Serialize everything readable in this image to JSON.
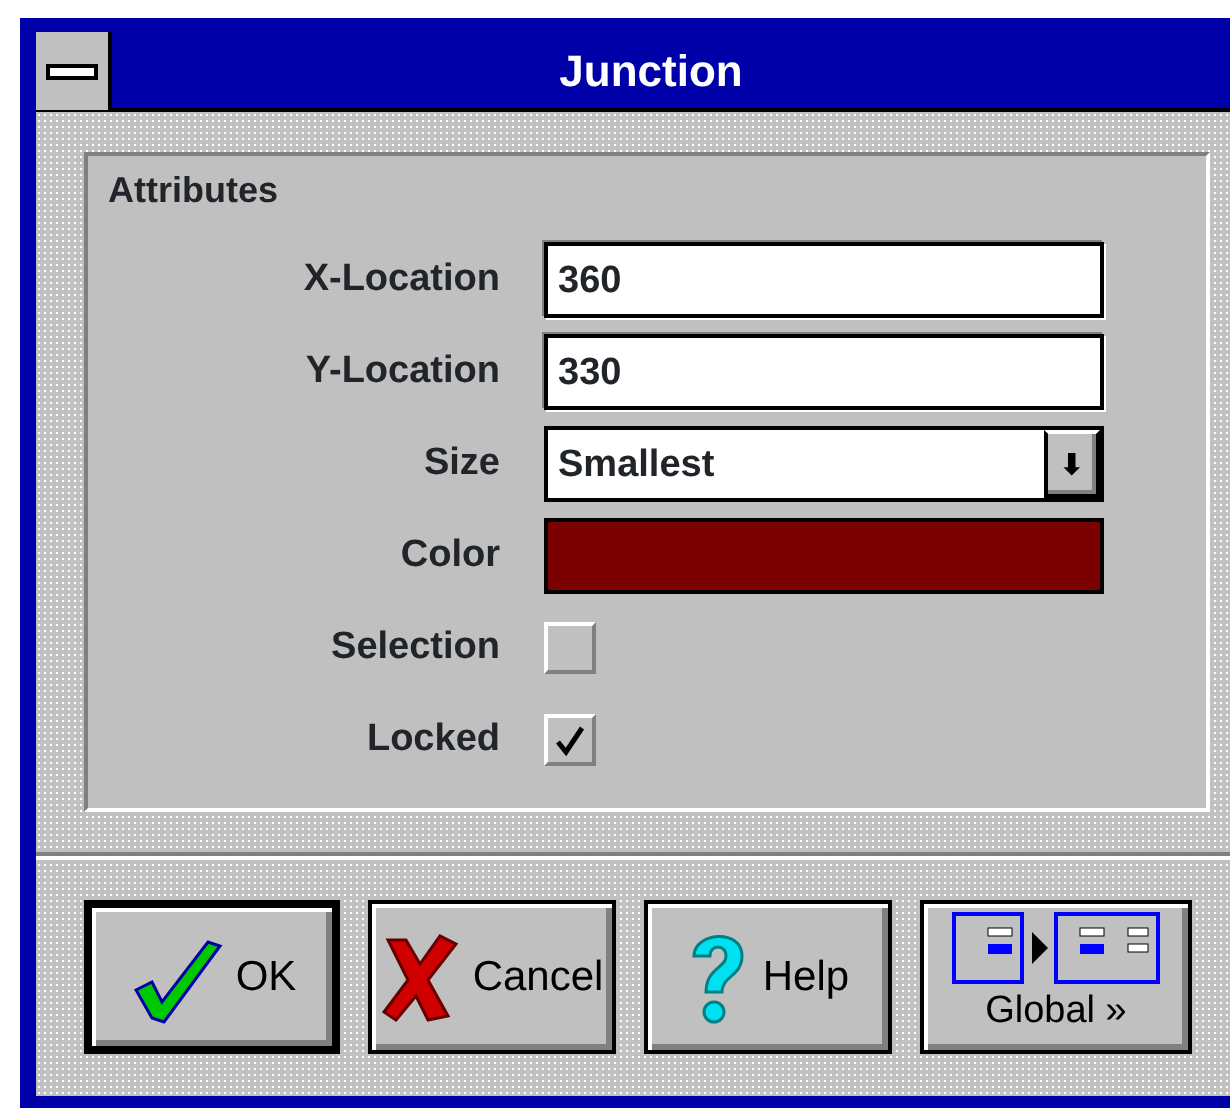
{
  "window": {
    "title": "Junction"
  },
  "group": {
    "title": "Attributes"
  },
  "fields": [
    {
      "kind": "text",
      "label": "X-Location",
      "value": "360"
    },
    {
      "kind": "text",
      "label": "Y-Location",
      "value": "330"
    },
    {
      "kind": "dropdown",
      "label": "Size",
      "value": "Smallest",
      "button": "⬇"
    },
    {
      "kind": "color",
      "label": "Color",
      "color": "#7b0000"
    },
    {
      "kind": "checkbox",
      "label": "Selection",
      "checked": false,
      "disabled": true
    },
    {
      "kind": "checkbox",
      "label": "Locked",
      "checked": true,
      "disabled": true
    }
  ],
  "buttons": [
    {
      "kind": "ok",
      "label": "OK",
      "default": true
    },
    {
      "kind": "cancel",
      "label": "Cancel",
      "default": false
    },
    {
      "kind": "help",
      "label": "Help",
      "default": false
    },
    {
      "kind": "global",
      "label": "Global »",
      "default": false
    }
  ]
}
